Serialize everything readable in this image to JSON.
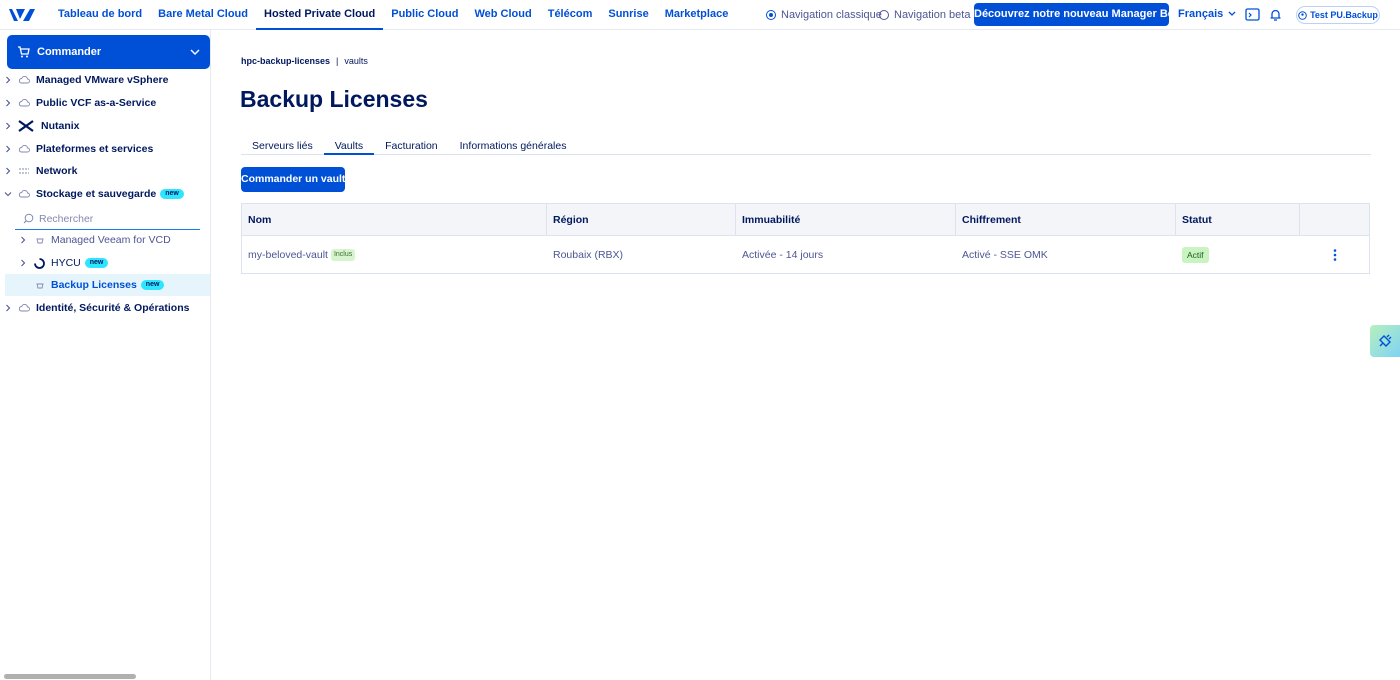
{
  "topbar": {
    "nav": [
      "Tableau de bord",
      "Bare Metal Cloud",
      "Hosted Private Cloud",
      "Public Cloud",
      "Web Cloud",
      "Télécom",
      "Sunrise",
      "Marketplace"
    ],
    "active_nav": "Hosted Private Cloud",
    "radio_classic": "Navigation classique",
    "radio_beta": "Navigation beta",
    "beta_button": "Découvrez notre nouveau Manager Beta",
    "language": "Français",
    "account": "Test PU.Backup"
  },
  "sidebar": {
    "order_button": "Commander",
    "items": [
      {
        "label": "Managed VMware vSphere"
      },
      {
        "label": "Public VCF as-a-Service"
      },
      {
        "label": "Nutanix"
      },
      {
        "label": "Plateformes et services"
      },
      {
        "label": "Network"
      },
      {
        "label": "Stockage et sauvegarde",
        "badge": "new"
      }
    ],
    "search_placeholder": "Rechercher",
    "children": [
      {
        "label": "Managed Veeam for VCD"
      },
      {
        "label": "HYCU",
        "badge": "new"
      },
      {
        "label": "Backup Licenses",
        "badge": "new"
      }
    ],
    "last_item": "Identité, Sécurité & Opérations"
  },
  "main": {
    "breadcrumb": [
      "hpc-backup-licenses",
      "vaults"
    ],
    "breadcrumb_sep": "|",
    "title": "Backup Licenses",
    "tabs": [
      "Serveurs liés",
      "Vaults",
      "Facturation",
      "Informations générales"
    ],
    "active_tab": "Vaults",
    "order_vault_button": "Commander un vault",
    "table": {
      "columns": [
        "Nom",
        "Région",
        "Immuabilité",
        "Chiffrement",
        "Statut"
      ],
      "rows": [
        {
          "name": "my-beloved-vault",
          "name_badge": "Inclus",
          "region": "Roubaix (RBX)",
          "immutability": "Activée - 14 jours",
          "encryption": "Activé - SSE OMK",
          "status": "Actif"
        }
      ]
    }
  },
  "colors": {
    "primary": "#0050d7",
    "navy": "#00185e",
    "muted": "#4d5693",
    "new_badge": "#2ee5ff",
    "status_ok": "#c9f3c0"
  }
}
